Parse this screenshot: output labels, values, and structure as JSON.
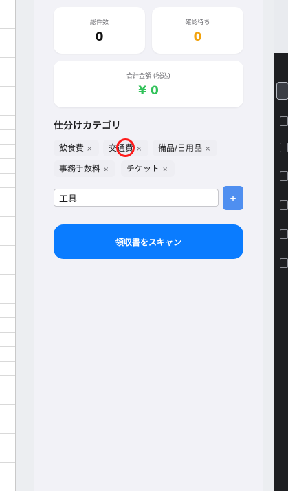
{
  "stats": {
    "total_label": "総件数",
    "total_value": "0",
    "pending_label": "確認待ち",
    "pending_value": "0",
    "amount_label": "合計金額 (税込)",
    "amount_value": "¥ 0"
  },
  "categories": {
    "title": "仕分けカテゴリ",
    "remove_glyph": "×",
    "items": [
      "飲食費",
      "交通費",
      "備品/日用品",
      "事務手数料",
      "チケット"
    ]
  },
  "new_category": {
    "value": "工具",
    "add_label": "+"
  },
  "scan_button_label": "領収書をスキャン",
  "colors": {
    "accent": "#0a7cff",
    "pending": "#f2a20c",
    "amount": "#32c25a",
    "highlight": "#ff1a1a"
  }
}
